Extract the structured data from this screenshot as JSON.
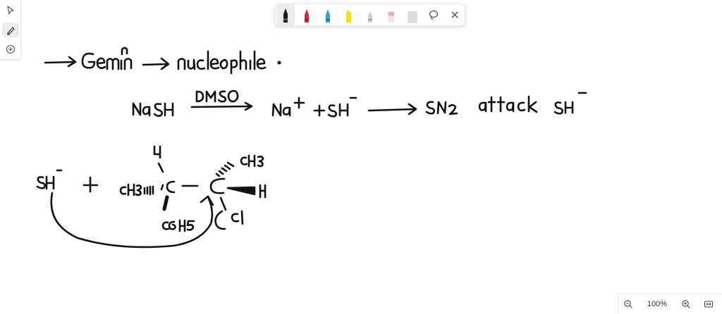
{
  "left_toolbar": {
    "tools": [
      "select-arrow",
      "ink-pen",
      "add-circle"
    ],
    "active": "ink-pen"
  },
  "pen_bar": {
    "pens": [
      {
        "name": "black-pen",
        "color": "#1a1a1a"
      },
      {
        "name": "red-pen",
        "color": "#d8283b"
      },
      {
        "name": "blue-pen",
        "color": "#2aa5dc"
      },
      {
        "name": "yellow-highlighter",
        "color": "#f4e200"
      },
      {
        "name": "gray-pen",
        "color": "#c8c8c8"
      },
      {
        "name": "pink-highlighter",
        "color": "#f2a3ad"
      },
      {
        "name": "gray-highlighter",
        "color": "#cfcfcf"
      }
    ],
    "selected": "black-pen",
    "extra_tools": [
      "lasso-icon",
      "close-icon"
    ]
  },
  "zoom": {
    "level": "100%"
  }
}
